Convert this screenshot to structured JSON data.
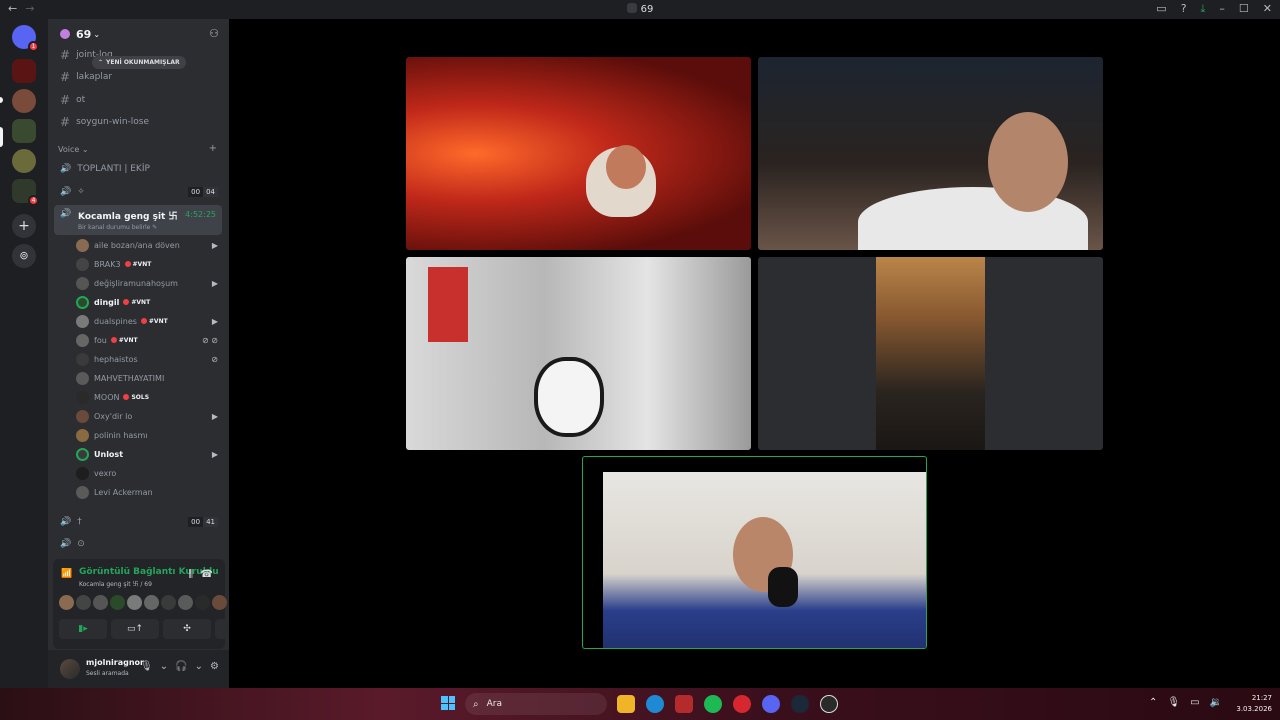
{
  "window": {
    "title": "69",
    "nav_back": "←",
    "nav_forward": "→",
    "icons": [
      "inbox-icon",
      "help-icon",
      "download-icon",
      "minimize-icon",
      "maximize-icon",
      "close-icon"
    ],
    "glyphs": [
      "▭",
      "?",
      "⤓",
      "–",
      "☐",
      "✕"
    ]
  },
  "server": {
    "name": "69",
    "chevron": "⌄"
  },
  "unread_pill": "YENİ OKUNMAMIŞLAR",
  "text_channels": [
    {
      "name": "joint-log"
    },
    {
      "name": "lakaplar"
    },
    {
      "name": "ot"
    },
    {
      "name": "soygun-win-lose"
    }
  ],
  "voice_category": "Voice ⌄",
  "voice_channels_top": [
    {
      "name": "TOPLANTI | EKİP"
    },
    {
      "name": "✧",
      "count_a": "00",
      "count_b": "04"
    }
  ],
  "active_voice": {
    "name": "Kocamla geng şit 卐",
    "timer": "4:52:25",
    "status": "Bir kanal durumu belirle ✎"
  },
  "members": [
    {
      "name": "aile bozan/ana döven",
      "tag": "",
      "indicator": "▶"
    },
    {
      "name": "BRAK3",
      "tag": "#VNT",
      "indicator": ""
    },
    {
      "name": "değişliramunahoşum",
      "tag": "",
      "indicator": "▶"
    },
    {
      "name": "dingil",
      "tag": "#VNT",
      "indicator": ""
    },
    {
      "name": "dualspines",
      "tag": "#VNT",
      "indicator": "▶"
    },
    {
      "name": "fou",
      "tag": "#VNT",
      "indicator": "⊘ ⊘"
    },
    {
      "name": "hephaistos",
      "tag": "",
      "indicator": "⊘"
    },
    {
      "name": "MAHVETHAYATIMI",
      "tag": "",
      "indicator": ""
    },
    {
      "name": "MOON",
      "tag": "SOLS",
      "indicator": ""
    },
    {
      "name": "Oxy'dir lo",
      "tag": "",
      "indicator": "▶"
    },
    {
      "name": "polinin hasmı",
      "tag": "",
      "indicator": ""
    },
    {
      "name": "Unlost",
      "tag": "",
      "indicator": "▶"
    },
    {
      "name": "vexro",
      "tag": "",
      "indicator": ""
    },
    {
      "name": "Levi Ackerman",
      "tag": "",
      "indicator": ""
    }
  ],
  "voice_channels_bottom": [
    {
      "name": "†",
      "count_a": "00",
      "count_b": "41"
    },
    {
      "name": "⊙"
    }
  ],
  "connection": {
    "title": "Görüntülü Bağlantı Kuruldu",
    "subtitle": "Kocamla geng şit 卐 / 69",
    "add": "+"
  },
  "user": {
    "name": "mjolniragnor",
    "status": "Sesli aramada"
  },
  "taskbar": {
    "search": "Ara",
    "time": "21:27",
    "date": "3.03.2026"
  },
  "colors": {
    "accent_green": "#23a55a",
    "danger_red": "#f23f43",
    "sidebar_bg": "#2b2d31",
    "rail_bg": "#1e1f22"
  }
}
